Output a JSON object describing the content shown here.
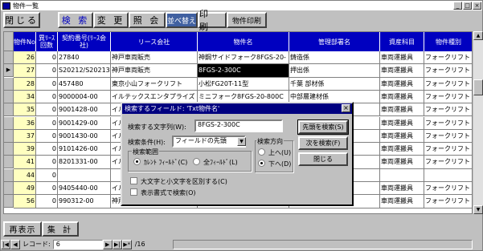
{
  "window": {
    "title": "物件一覧",
    "min": "_",
    "max": "□",
    "close": "×"
  },
  "toolbar": {
    "close": "閉じる",
    "search": "検 索",
    "change": "変 更",
    "browse": "照 会",
    "sort": "並べ替え",
    "print": "印 刷",
    "item_print": "物件印刷"
  },
  "columns": [
    "物件No",
    "異ﾘｰｽ回数",
    "契約番号(ﾘｰｽ会社)",
    "リース会社",
    "物件名",
    "管理部署名",
    "資産科目",
    "物件種別"
  ],
  "rows": [
    {
      "id": "26",
      "count": "0",
      "contract": "27840",
      "company": "神戸車両販売",
      "item": "神鋼サイドフォーク8FGS-20-",
      "dept": "鋳造係",
      "asset": "車両運搬具",
      "type": "フォークリフト"
    },
    {
      "id": "27",
      "count": "0",
      "contract": "S20212/S20213",
      "company": "神戸車両販売",
      "item": "8FGS-2-300C",
      "dept": "押出係",
      "asset": "車両運搬具",
      "type": "フォークリフト"
    },
    {
      "id": "28",
      "count": "0",
      "contract": "457480",
      "company": "東京小山フォークリフト",
      "item": "小松FG20T-11型",
      "dept": "千葉 部材係",
      "asset": "車両運搬具",
      "type": "フォークリフト"
    },
    {
      "id": "34",
      "count": "0",
      "contract": "9000004-00",
      "company": "イルテックスエンタプライズ",
      "item": "ミニフォーク8FGS-20-800C",
      "dept": "中部層建材係",
      "asset": "車両運搬具",
      "type": "フォークリフト"
    },
    {
      "id": "35",
      "count": "0",
      "contract": "9001428-00",
      "company": "イル",
      "item": "",
      "dept": "",
      "asset": "車両運搬具",
      "type": "フォークリフト"
    },
    {
      "id": "36",
      "count": "0",
      "contract": "9001429-00",
      "company": "イル",
      "item": "",
      "dept": "",
      "asset": "車両運搬具",
      "type": "フォークリフト"
    },
    {
      "id": "37",
      "count": "0",
      "contract": "9001430-00",
      "company": "イル",
      "item": "",
      "dept": "",
      "asset": "車両運搬具",
      "type": "フォークリフト"
    },
    {
      "id": "39",
      "count": "0",
      "contract": "9101426-00",
      "company": "イル",
      "item": "",
      "dept": "",
      "asset": "車両運搬具",
      "type": "フォークリフト"
    },
    {
      "id": "41",
      "count": "0",
      "contract": "8201331-00",
      "company": "イル",
      "item": "",
      "dept": "",
      "asset": "車両運搬具",
      "type": "フォークリフト"
    },
    {
      "id": "44",
      "count": "0",
      "contract": "",
      "company": "",
      "item": "",
      "dept": "",
      "asset": "",
      "type": ""
    },
    {
      "id": "49",
      "count": "0",
      "contract": "9405440-00",
      "company": "イル",
      "item": "",
      "dept": "",
      "asset": "車両運搬具",
      "type": "フォークリフト"
    },
    {
      "id": "56",
      "count": "0",
      "contract": "990312-00",
      "company": "神戸車両販売",
      "item": "",
      "dept": "押出係",
      "asset": "車両運搬具",
      "type": "フォークリフト"
    }
  ],
  "bottom": {
    "redisplay": "再表示",
    "total": "集 計"
  },
  "status": {
    "record_label": "レコード:",
    "record_value": "6",
    "total": "/16"
  },
  "dialog": {
    "title": "検索するフィールド: 'Txt物件名'",
    "search_label": "検索する文字列(W):",
    "search_value": "8FGS-2-300C",
    "condition_label": "検索条件(H):",
    "condition_value": "フィールドの先頭",
    "direction_label": "検索方向",
    "up": "上へ(U)",
    "down": "下へ(D)",
    "range_label": "検索範囲",
    "current_field": "ｶﾚﾝﾄ ﾌｨｰﾙﾄﾞ(C)",
    "all_fields": "全ﾌｨｰﾙﾄﾞ(L)",
    "case_label": "大文字と小文字を区別する(C)",
    "format_label": "表示書式で検索(O)",
    "find_first": "先頭を検索(S)",
    "find_next": "次を検索(F)",
    "close": "閉じる"
  }
}
